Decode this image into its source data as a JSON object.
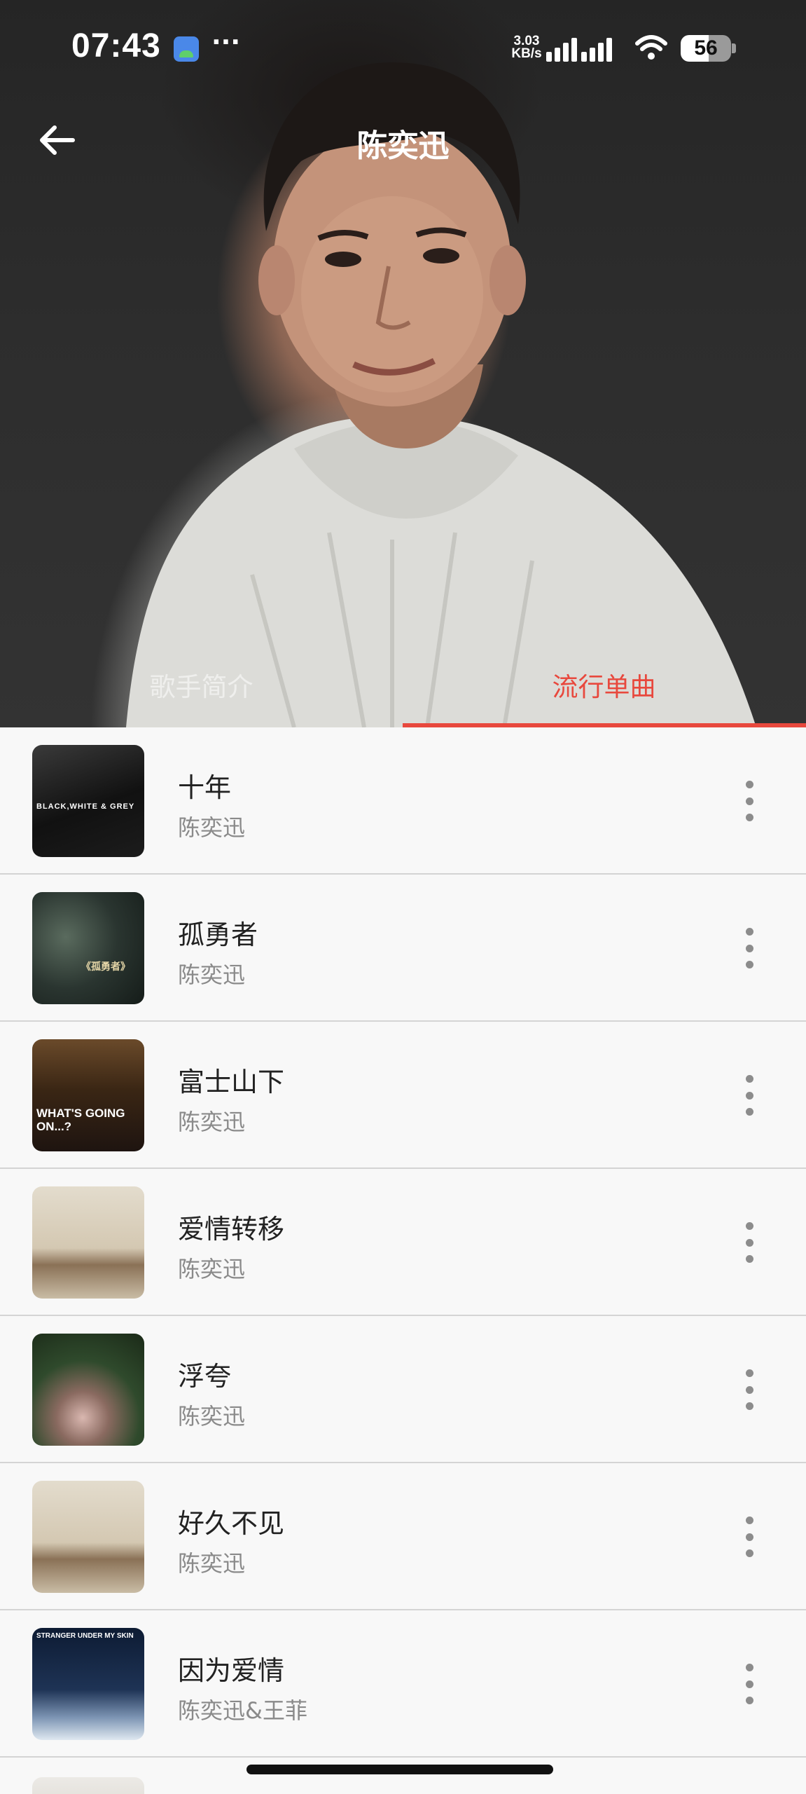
{
  "status_bar": {
    "time": "07:43",
    "more": "···",
    "net_speed_value": "3.03",
    "net_speed_unit": "KB/s",
    "battery": "56",
    "battery_level": 0.56
  },
  "header": {
    "title": "陈奕迅",
    "back_icon": "arrow-left-icon"
  },
  "tabs": [
    {
      "label": "歌手简介",
      "active": false
    },
    {
      "label": "流行单曲",
      "active": true
    }
  ],
  "colors": {
    "accent": "#e8483d",
    "title_text": "#222222",
    "secondary_text": "#8a8a8a",
    "divider": "#d4d4d4"
  },
  "songs": [
    {
      "title": "十年",
      "artist": "陈奕迅",
      "cover_text": "BLACK,WHITE & GREY"
    },
    {
      "title": "孤勇者",
      "artist": "陈奕迅",
      "cover_text": "《孤勇者》"
    },
    {
      "title": "富士山下",
      "artist": "陈奕迅",
      "cover_text": "WHAT'S GOING ON...?"
    },
    {
      "title": "爱情转移",
      "artist": "陈奕迅",
      "cover_text": ""
    },
    {
      "title": "浮夸",
      "artist": "陈奕迅",
      "cover_text": ""
    },
    {
      "title": "好久不见",
      "artist": "陈奕迅",
      "cover_text": ""
    },
    {
      "title": "因为爱情",
      "artist": "陈奕迅&王菲",
      "cover_text": "STRANGER UNDER MY SKIN"
    }
  ]
}
